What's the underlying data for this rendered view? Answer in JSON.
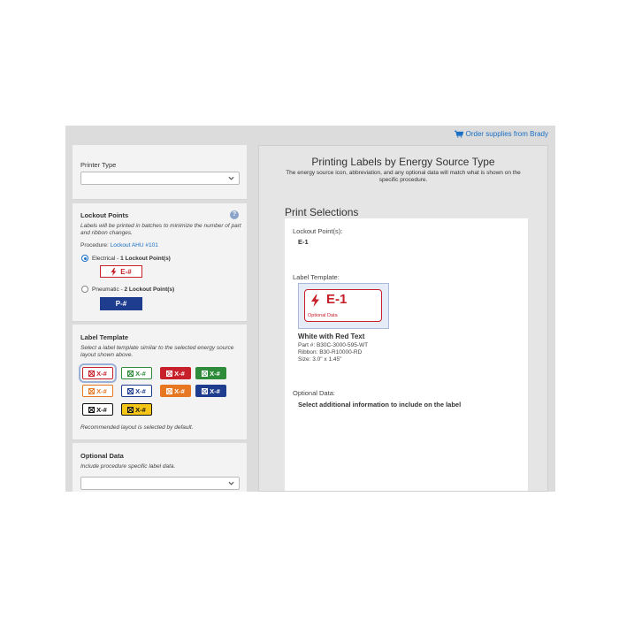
{
  "header": {
    "order_link": "Order supplies from Brady",
    "link_color": "#1a6fc4"
  },
  "printer_panel": {
    "label": "Printer Type",
    "selected": ""
  },
  "lockout_panel": {
    "title": "Lockout Points",
    "help_icon": "?",
    "help": "Labels will be printed in batches to minimize the number of part and ribbon changes.",
    "procedure_label": "Procedure:",
    "procedure_link": "Lockout AHU #101",
    "options": [
      {
        "source": "Electrical - ",
        "count": "1 Lockout Point(s)",
        "tag": "E-#",
        "checked": true,
        "color": "#c8202a"
      },
      {
        "source": "Pneumatic - ",
        "count": "2 Lockout Point(s)",
        "tag": "P-#",
        "checked": false,
        "color": "#1e3d8f"
      }
    ]
  },
  "template_panel": {
    "title": "Label Template",
    "help": "Select a label template similar to the selected energy source layout shown above.",
    "templates": [
      {
        "text": "X-#",
        "bg": "#ffffff",
        "fg": "#c8202a",
        "border": "#c8202a",
        "selected": true
      },
      {
        "text": "X-#",
        "bg": "#ffffff",
        "fg": "#2e8b3a",
        "border": "#2e8b3a",
        "selected": false
      },
      {
        "text": "X-#",
        "bg": "#c8202a",
        "fg": "#ffffff",
        "border": "#c8202a",
        "selected": false
      },
      {
        "text": "X-#",
        "bg": "#2e8b3a",
        "fg": "#ffffff",
        "border": "#2e8b3a",
        "selected": false
      },
      {
        "text": "X-#",
        "bg": "#ffffff",
        "fg": "#e87722",
        "border": "#e87722",
        "selected": false
      },
      {
        "text": "X-#",
        "bg": "#ffffff",
        "fg": "#1e3d8f",
        "border": "#1e3d8f",
        "selected": false
      },
      {
        "text": "X-#",
        "bg": "#e87722",
        "fg": "#ffffff",
        "border": "#e87722",
        "selected": false
      },
      {
        "text": "X-#",
        "bg": "#1e3d8f",
        "fg": "#ffffff",
        "border": "#1e3d8f",
        "selected": false
      },
      {
        "text": "X-#",
        "bg": "#ffffff",
        "fg": "#111111",
        "border": "#111111",
        "selected": false
      },
      {
        "text": "X-#",
        "bg": "#f5c518",
        "fg": "#111111",
        "border": "#111111",
        "selected": false
      }
    ],
    "recommended": "Recommended layout is selected by default."
  },
  "optional_panel": {
    "title": "Optional Data",
    "help": "Include procedure specific label data.",
    "selected": ""
  },
  "main": {
    "title": "Printing Labels by Energy Source Type",
    "subtitle": "The energy source icon, abbreviation, and any optional data will match what is shown on the specific procedure.",
    "section_title": "Print Selections",
    "lockout_label": "Lockout Point(s):",
    "lockout_value": "E-1",
    "template_label": "Label Template:",
    "preview": {
      "code": "E-1",
      "optional": "Optional Data",
      "icon": "lightning-bolt-icon"
    },
    "template_name": "White with Red Text",
    "part": "Part #: B30C-3000-595-WT",
    "ribbon": "Ribbon: B30-R10000-RD",
    "size": "Size: 3.0\" x 1.45\"",
    "optional_label": "Optional Data:",
    "optional_value": "Select additional information to include on the label"
  }
}
